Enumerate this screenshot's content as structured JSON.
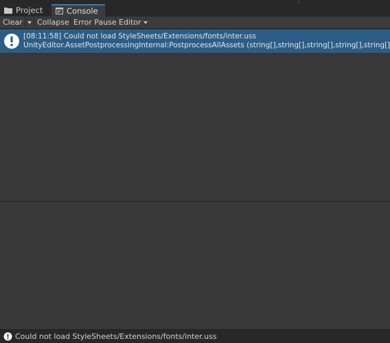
{
  "tabs": {
    "project_label": "Project",
    "console_label": "Console"
  },
  "toolbar": {
    "clear_label": "Clear",
    "collapse_label": "Collapse",
    "error_pause_label": "Error Pause",
    "editor_label": "Editor"
  },
  "log": {
    "entries": [
      {
        "line1": "[08:11:58] Could not load StyleSheets/Extensions/fonts/inter.uss",
        "line2": "UnityEditor.AssetPostprocessingInternal:PostprocessAllAssets (string[],string[],string[],string[],string[])",
        "icon": "info-icon"
      }
    ]
  },
  "statusbar": {
    "message": "Could not load StyleSheets/Extensions/fonts/inter.uss",
    "icon": "info-icon"
  },
  "colors": {
    "selected_row": "#2c5d87",
    "active_tab_accent": "#3a79bb",
    "background": "#383838"
  }
}
